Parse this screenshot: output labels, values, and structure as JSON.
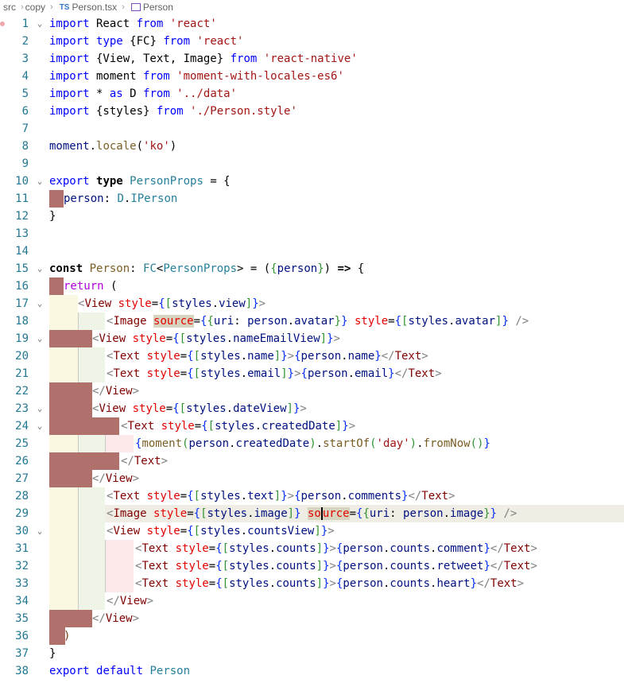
{
  "breadcrumb": {
    "items": [
      "src",
      "copy",
      "Person.tsx",
      "Person"
    ],
    "lang_badge": "TS"
  },
  "editor": {
    "lines": [
      {
        "n": 1,
        "fold": true
      },
      {
        "n": 2
      },
      {
        "n": 3
      },
      {
        "n": 4
      },
      {
        "n": 5
      },
      {
        "n": 6
      },
      {
        "n": 7
      },
      {
        "n": 8
      },
      {
        "n": 9
      },
      {
        "n": 10,
        "fold": true
      },
      {
        "n": 11
      },
      {
        "n": 12
      },
      {
        "n": 13
      },
      {
        "n": 14
      },
      {
        "n": 15,
        "fold": true
      },
      {
        "n": 16
      },
      {
        "n": 17,
        "fold": true
      },
      {
        "n": 18
      },
      {
        "n": 19,
        "fold": true
      },
      {
        "n": 20
      },
      {
        "n": 21
      },
      {
        "n": 22
      },
      {
        "n": 23,
        "fold": true
      },
      {
        "n": 24,
        "fold": true
      },
      {
        "n": 25
      },
      {
        "n": 26
      },
      {
        "n": 27
      },
      {
        "n": 28
      },
      {
        "n": 29
      },
      {
        "n": 30,
        "fold": true
      },
      {
        "n": 31
      },
      {
        "n": 32
      },
      {
        "n": 33
      },
      {
        "n": 34
      },
      {
        "n": 35
      },
      {
        "n": 36
      },
      {
        "n": 37
      },
      {
        "n": 38
      }
    ],
    "highlighted_line": 29,
    "code": {
      "l1": [
        "import",
        " React ",
        "from",
        " 'react'"
      ],
      "l2": [
        "import",
        " ",
        "type",
        " {FC} ",
        "from",
        " 'react'"
      ],
      "l3": [
        "import",
        " {View, Text, Image} ",
        "from",
        " 'react-native'"
      ],
      "l4": [
        "import",
        " moment ",
        "from",
        " 'moment-with-locales-es6'"
      ],
      "l5": [
        "import",
        " * ",
        "as",
        " D ",
        "from",
        " '../data'"
      ],
      "l6": [
        "import",
        " {styles} ",
        "from",
        " './Person.style'"
      ],
      "l8": [
        "moment",
        ".",
        "locale",
        "(",
        "'ko'",
        ")"
      ],
      "l10": [
        "export",
        " ",
        "type",
        " ",
        "PersonProps",
        " = {"
      ],
      "l11": [
        "person",
        ": ",
        "D",
        ".",
        "IPerson"
      ],
      "l12": [
        "}"
      ],
      "l15": [
        "const",
        " ",
        "Person",
        ": ",
        "FC",
        "<",
        "PersonProps",
        "> = (",
        "{",
        "person",
        "}",
        ") ",
        "=>",
        " {"
      ],
      "l16": [
        "return",
        " ("
      ],
      "l17": [
        "<",
        "View",
        " ",
        "style",
        "=",
        "{",
        "[",
        "styles",
        ".",
        "view",
        "]",
        "}",
        ">"
      ],
      "l18": [
        "<",
        "Image",
        " ",
        "source",
        "=",
        "{",
        "{",
        "uri",
        ": ",
        "person",
        ".",
        "avatar",
        "}",
        "}",
        " ",
        "style",
        "=",
        "{",
        "[",
        "styles",
        ".",
        "avatar",
        "]",
        "}",
        " />"
      ],
      "l19": [
        "<",
        "View",
        " ",
        "style",
        "=",
        "{",
        "[",
        "styles",
        ".",
        "nameEmailView",
        "]",
        "}",
        ">"
      ],
      "l20": [
        "<",
        "Text",
        " ",
        "style",
        "=",
        "{",
        "[",
        "styles",
        ".",
        "name",
        "]",
        "}",
        ">",
        "{",
        "person",
        ".",
        "name",
        "}",
        "</",
        "Text",
        ">"
      ],
      "l21": [
        "<",
        "Text",
        " ",
        "style",
        "=",
        "{",
        "[",
        "styles",
        ".",
        "email",
        "]",
        "}",
        ">",
        "{",
        "person",
        ".",
        "email",
        "}",
        "</",
        "Text",
        ">"
      ],
      "l22": [
        "</",
        "View",
        ">"
      ],
      "l23": [
        "<",
        "View",
        " ",
        "style",
        "=",
        "{",
        "[",
        "styles",
        ".",
        "dateView",
        "]",
        "}",
        ">"
      ],
      "l24": [
        "<",
        "Text",
        " ",
        "style",
        "=",
        "{",
        "[",
        "styles",
        ".",
        "createdDate",
        "]",
        "}",
        ">"
      ],
      "l25": [
        "{",
        "moment",
        "(",
        "person",
        ".",
        "createdDate",
        ")",
        ".",
        "startOf",
        "(",
        "'day'",
        ")",
        ".",
        "fromNow",
        "(",
        ")",
        "}"
      ],
      "l26": [
        "</",
        "Text",
        ">"
      ],
      "l27": [
        "</",
        "View",
        ">"
      ],
      "l28": [
        "<",
        "Text",
        " ",
        "style",
        "=",
        "{",
        "[",
        "styles",
        ".",
        "text",
        "]",
        "}",
        ">",
        "{",
        "person",
        ".",
        "comments",
        "}",
        "</",
        "Text",
        ">"
      ],
      "l29": [
        "<",
        "Image",
        " ",
        "style",
        "=",
        "{",
        "[",
        "styles",
        ".",
        "image",
        "]",
        "}",
        " ",
        "so",
        "urce",
        "=",
        "{",
        "{",
        "uri",
        ": ",
        "person",
        ".",
        "image",
        "}",
        "}",
        " />"
      ],
      "l30": [
        "<",
        "View",
        " ",
        "style",
        "=",
        "{",
        "[",
        "styles",
        ".",
        "countsView",
        "]",
        "}",
        ">"
      ],
      "l31": [
        "<",
        "Text",
        " ",
        "style",
        "=",
        "{",
        "[",
        "styles",
        ".",
        "counts",
        "]",
        "}",
        ">",
        "{",
        "person",
        ".",
        "counts",
        ".",
        "comment",
        "}",
        "</",
        "Text",
        ">"
      ],
      "l32": [
        "<",
        "Text",
        " ",
        "style",
        "=",
        "{",
        "[",
        "styles",
        ".",
        "counts",
        "]",
        "}",
        ">",
        "{",
        "person",
        ".",
        "counts",
        ".",
        "retweet",
        "}",
        "</",
        "Text",
        ">"
      ],
      "l33": [
        "<",
        "Text",
        " ",
        "style",
        "=",
        "{",
        "[",
        "styles",
        ".",
        "counts",
        "]",
        "}",
        ">",
        "{",
        "person",
        ".",
        "counts",
        ".",
        "heart",
        "}",
        "</",
        "Text",
        ">"
      ],
      "l34": [
        "</",
        "View",
        ">"
      ],
      "l35": [
        "</",
        "View",
        ">"
      ],
      "l36": [
        ")"
      ],
      "l37": [
        "}"
      ],
      "l38": [
        "export",
        " ",
        "default",
        " ",
        "Person"
      ]
    }
  },
  "colors": {
    "keyword": "#0000ff",
    "control_keyword": "#af00db",
    "string": "#a31515",
    "type": "#267f99",
    "variable": "#001080",
    "function": "#795e26",
    "jsx_tag": "#800000",
    "jsx_attr": "#e50000",
    "line_number": "#237893",
    "error_indent": "#b0706c"
  }
}
